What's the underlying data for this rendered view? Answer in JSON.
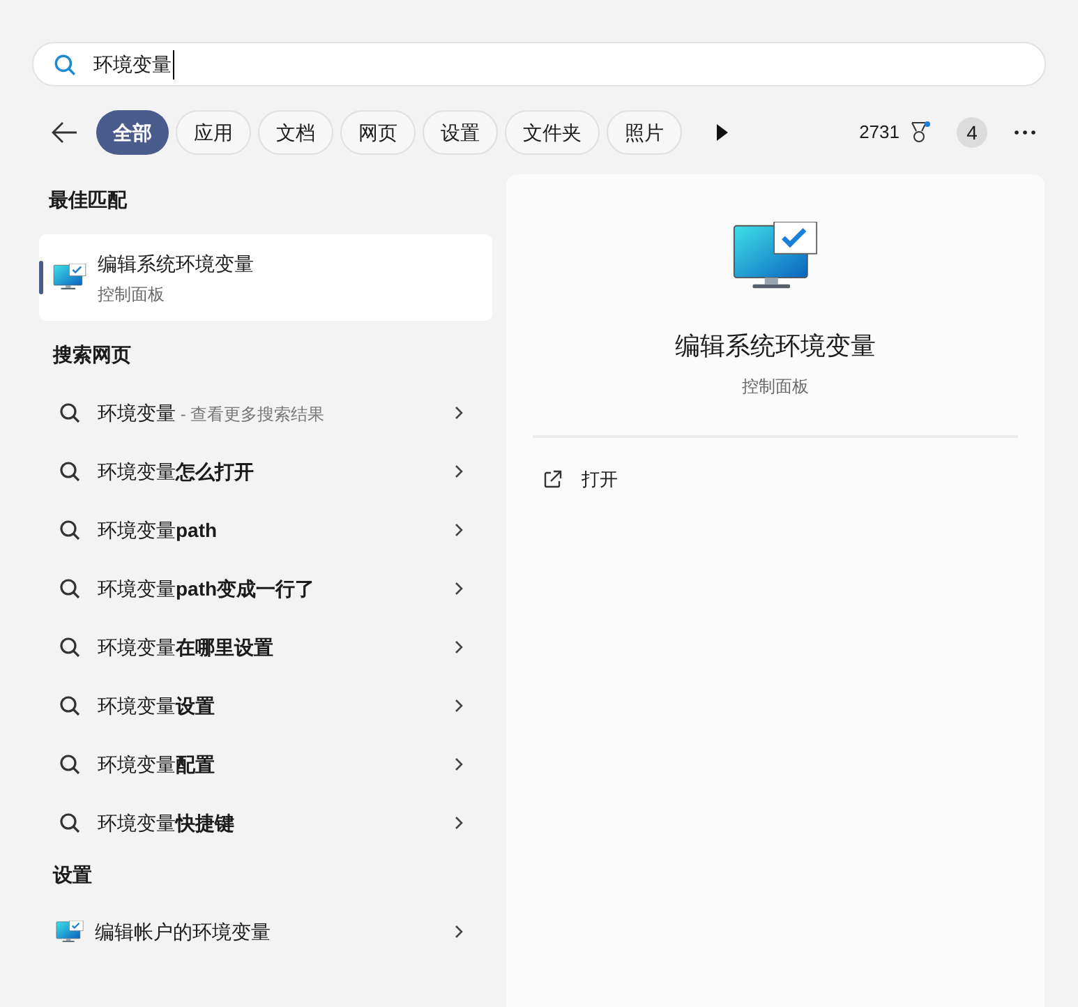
{
  "search": {
    "value": "环境变量"
  },
  "filters": [
    {
      "label": "全部",
      "selected": true
    },
    {
      "label": "应用",
      "selected": false
    },
    {
      "label": "文档",
      "selected": false
    },
    {
      "label": "网页",
      "selected": false
    },
    {
      "label": "设置",
      "selected": false
    },
    {
      "label": "文件夹",
      "selected": false
    },
    {
      "label": "照片",
      "selected": false
    }
  ],
  "points": "2731",
  "badge": "4",
  "best_match": {
    "heading": "最佳匹配",
    "title": "编辑系统环境变量",
    "subtitle": "控制面板",
    "selected": true
  },
  "web": {
    "heading": "搜索网页",
    "items": [
      {
        "text": "环境变量",
        "hint": " - 查看更多搜索结果"
      },
      {
        "text": "环境变量**怎么打开**"
      },
      {
        "text": "环境变量**path**"
      },
      {
        "text": "环境变量**path变成一行了**"
      },
      {
        "text": "环境变量**在哪里设置**"
      },
      {
        "text": "环境变量**设置**"
      },
      {
        "text": "环境变量**配置**"
      },
      {
        "text": "环境变量**快捷键**"
      }
    ]
  },
  "settings": {
    "heading": "设置",
    "items": [
      {
        "title": "编辑帐户的环境变量"
      }
    ]
  },
  "detail": {
    "title": "编辑系统环境变量",
    "subtitle": "控制面板",
    "actions": [
      {
        "label": "打开"
      }
    ]
  }
}
